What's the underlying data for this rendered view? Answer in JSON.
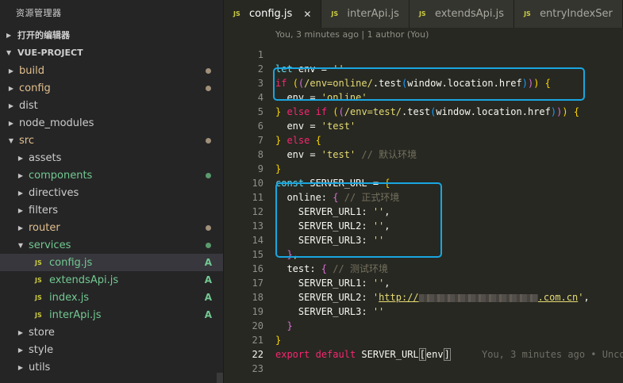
{
  "sidebar": {
    "title": "资源管理器",
    "open_editors_label": "打开的编辑器",
    "project_label": "VUE-PROJECT",
    "items": [
      {
        "label": "build",
        "expanded": false,
        "depth": 0,
        "color": "#e2c08d",
        "status": "dot",
        "status_color": "#a0907a"
      },
      {
        "label": "config",
        "expanded": false,
        "depth": 0,
        "color": "#e2c08d",
        "status": "dot",
        "status_color": "#a0907a"
      },
      {
        "label": "dist",
        "expanded": false,
        "depth": 0,
        "color": "#cccccc",
        "status": "none"
      },
      {
        "label": "node_modules",
        "expanded": false,
        "depth": 0,
        "color": "#cccccc",
        "status": "none"
      },
      {
        "label": "src",
        "expanded": true,
        "depth": 0,
        "color": "#e2c08d",
        "status": "dot",
        "status_color": "#a0907a"
      },
      {
        "label": "assets",
        "expanded": false,
        "depth": 1,
        "color": "#cccccc",
        "status": "none"
      },
      {
        "label": "components",
        "expanded": false,
        "depth": 1,
        "color": "#73c991",
        "status": "dot",
        "status_color": "#5a9a6c"
      },
      {
        "label": "directives",
        "expanded": false,
        "depth": 1,
        "color": "#cccccc",
        "status": "none"
      },
      {
        "label": "filters",
        "expanded": false,
        "depth": 1,
        "color": "#cccccc",
        "status": "none"
      },
      {
        "label": "router",
        "expanded": false,
        "depth": 1,
        "color": "#e2c08d",
        "status": "dot",
        "status_color": "#a0907a"
      },
      {
        "label": "services",
        "expanded": true,
        "depth": 1,
        "color": "#73c991",
        "status": "dot",
        "status_color": "#5a9a6c"
      },
      {
        "label": "config.js",
        "file": true,
        "depth": 2,
        "color": "#73c991",
        "status": "A",
        "selected": true
      },
      {
        "label": "extendsApi.js",
        "file": true,
        "depth": 2,
        "color": "#73c991",
        "status": "A"
      },
      {
        "label": "index.js",
        "file": true,
        "depth": 2,
        "color": "#73c991",
        "status": "A"
      },
      {
        "label": "interApi.js",
        "file": true,
        "depth": 2,
        "color": "#73c991",
        "status": "A"
      },
      {
        "label": "store",
        "expanded": false,
        "depth": 1,
        "color": "#cccccc",
        "status": "none"
      },
      {
        "label": "style",
        "expanded": false,
        "depth": 1,
        "color": "#cccccc",
        "status": "none"
      },
      {
        "label": "utils",
        "expanded": false,
        "depth": 1,
        "color": "#cccccc",
        "status": "none"
      }
    ],
    "file_icon_text": "JS",
    "added_badge": "A"
  },
  "tabs": [
    {
      "label": "config.js",
      "active": true,
      "close": "✕"
    },
    {
      "label": "interApi.js",
      "active": false
    },
    {
      "label": "extendsApi.js",
      "active": false
    },
    {
      "label": "entryIndexSer",
      "active": false
    }
  ],
  "editor": {
    "codelens": "You, 3 minutes ago | 1 author (You)",
    "current_line": 22,
    "line_numbers": [
      "1",
      "2",
      "3",
      "4",
      "5",
      "6",
      "7",
      "8",
      "9",
      "10",
      "11",
      "12",
      "13",
      "14",
      "15",
      "16",
      "17",
      "18",
      "19",
      "20",
      "21",
      "22",
      "23"
    ],
    "blame": "You, 3 minutes ago • Unco",
    "comments": {
      "default_env": "// 默认环境",
      "formal_env": "// 正式环境",
      "test_env": "// 测试环境"
    },
    "url_prefix": "http://",
    "url_suffix": ".com.cn"
  },
  "colors": {
    "highlight_box": "#19a6e0",
    "added": "#73c991",
    "modified": "#e2c08d"
  }
}
